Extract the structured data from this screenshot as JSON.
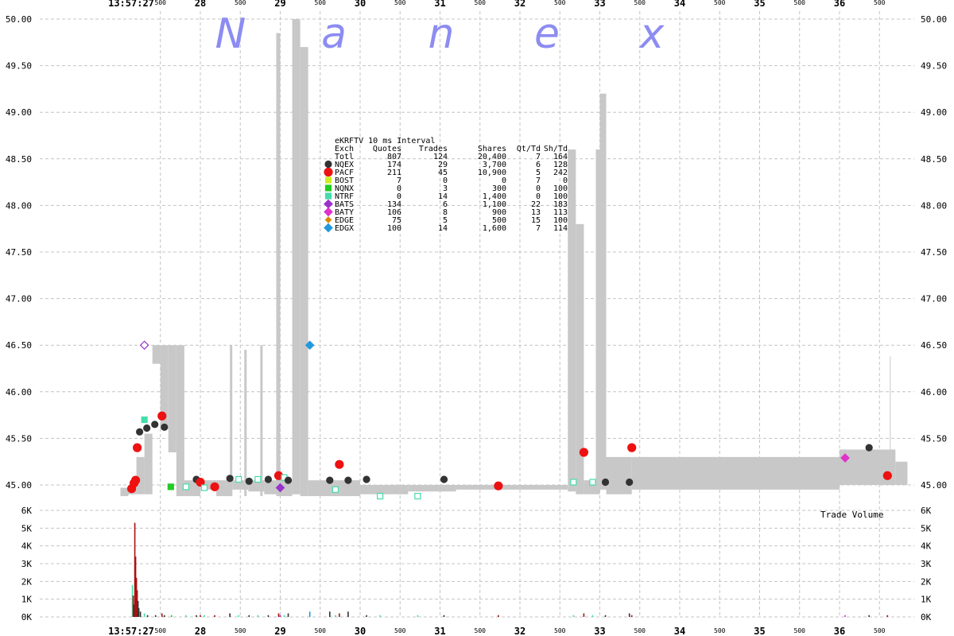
{
  "chart_data": {
    "type": "scatter",
    "subtype": "quote-range-with-trades-and-volume",
    "brand_letters": [
      "N",
      "a",
      "n",
      "e",
      "x"
    ],
    "title": "eKRFTV 10 ms Interval",
    "price_axis": {
      "ylim": [
        44.88,
        50.0
      ],
      "ticks": [
        "50.00",
        "49.50",
        "49.00",
        "48.50",
        "48.00",
        "47.50",
        "47.00",
        "46.50",
        "46.00",
        "45.50",
        "45.00"
      ]
    },
    "volume_axis": {
      "label": "Trade Volume",
      "ylim": [
        0,
        6000
      ],
      "ticks": [
        "6K",
        "5K",
        "4K",
        "3K",
        "2K",
        "1K",
        "0K"
      ]
    },
    "time_axis": {
      "second_labels": [
        "28",
        "29",
        "30",
        "31",
        "32",
        "33",
        "34",
        "35",
        "36"
      ],
      "start_time_label": "13:57:27",
      "ms_label": "500",
      "xlim": [
        27.0,
        37.0
      ],
      "grid": true
    },
    "legend": {
      "header": [
        "Exch",
        "Quotes",
        "Trades",
        "Shares",
        "Qt/Td",
        "Sh/Td"
      ],
      "rows": [
        {
          "exch": "Totl",
          "quotes": "807",
          "trades": "124",
          "shares": "20,400",
          "qt_td": "7",
          "sh_td": "164",
          "marker": "none",
          "color": ""
        },
        {
          "exch": "NQEX",
          "quotes": "174",
          "trades": "29",
          "shares": "3,700",
          "qt_td": "6",
          "sh_td": "128",
          "marker": "circle",
          "color": "#333333"
        },
        {
          "exch": "PACF",
          "quotes": "211",
          "trades": "45",
          "shares": "10,900",
          "qt_td": "5",
          "sh_td": "242",
          "marker": "circle-lg",
          "color": "#ee1111"
        },
        {
          "exch": "BOST",
          "quotes": "7",
          "trades": "0",
          "shares": "0",
          "qt_td": "7",
          "sh_td": "0",
          "marker": "square",
          "color": "#ccee22"
        },
        {
          "exch": "NQNX",
          "quotes": "0",
          "trades": "3",
          "shares": "300",
          "qt_td": "0",
          "sh_td": "100",
          "marker": "square",
          "color": "#22cc22"
        },
        {
          "exch": "NTRF",
          "quotes": "0",
          "trades": "14",
          "shares": "1,400",
          "qt_td": "0",
          "sh_td": "100",
          "marker": "square",
          "color": "#44ddaa"
        },
        {
          "exch": "BATS",
          "quotes": "134",
          "trades": "6",
          "shares": "1,100",
          "qt_td": "22",
          "sh_td": "183",
          "marker": "diamond",
          "color": "#9933cc"
        },
        {
          "exch": "BATY",
          "quotes": "106",
          "trades": "8",
          "shares": "900",
          "qt_td": "13",
          "sh_td": "113",
          "marker": "diamond",
          "color": "#dd33cc"
        },
        {
          "exch": "EDGE",
          "quotes": "75",
          "trades": "5",
          "shares": "500",
          "qt_td": "15",
          "sh_td": "100",
          "marker": "diamond-sm",
          "color": "#dd8800"
        },
        {
          "exch": "EDGX",
          "quotes": "100",
          "trades": "14",
          "shares": "1,600",
          "qt_td": "7",
          "sh_td": "114",
          "marker": "diamond",
          "color": "#2299dd"
        }
      ]
    },
    "quote_range": {
      "color": "#c8c8c8",
      "segments": [
        [
          27.0,
          27.1,
          44.88,
          44.97
        ],
        [
          27.1,
          27.2,
          44.9,
          45.0
        ],
        [
          27.2,
          27.3,
          44.9,
          45.3
        ],
        [
          27.3,
          27.4,
          44.9,
          45.55
        ],
        [
          27.4,
          27.5,
          46.3,
          46.5
        ],
        [
          27.5,
          27.6,
          45.6,
          46.5
        ],
        [
          27.6,
          27.7,
          45.35,
          46.5
        ],
        [
          27.7,
          27.8,
          44.88,
          46.5
        ],
        [
          27.8,
          28.0,
          44.88,
          45.05
        ],
        [
          28.0,
          28.2,
          44.95,
          45.05
        ],
        [
          28.2,
          28.4,
          44.88,
          45.05
        ],
        [
          28.37,
          28.4,
          44.88,
          46.5
        ],
        [
          28.4,
          28.6,
          44.95,
          45.05
        ],
        [
          28.55,
          28.58,
          44.88,
          46.45
        ],
        [
          28.6,
          28.8,
          44.93,
          45.05
        ],
        [
          28.75,
          28.78,
          44.88,
          46.5
        ],
        [
          28.8,
          28.95,
          44.9,
          45.05
        ],
        [
          28.95,
          29.0,
          44.88,
          49.85
        ],
        [
          29.0,
          29.15,
          44.88,
          45.05
        ],
        [
          29.15,
          29.25,
          44.9,
          50.0
        ],
        [
          29.25,
          29.35,
          44.88,
          49.7
        ],
        [
          29.35,
          30.0,
          44.88,
          45.05
        ],
        [
          30.0,
          30.6,
          44.9,
          45.0
        ],
        [
          30.6,
          31.2,
          44.93,
          45.0
        ],
        [
          31.2,
          32.0,
          44.95,
          45.0
        ],
        [
          32.0,
          32.6,
          44.95,
          45.0
        ],
        [
          32.6,
          32.7,
          44.93,
          48.6
        ],
        [
          32.7,
          32.8,
          44.9,
          47.8
        ],
        [
          32.8,
          32.95,
          44.9,
          45.05
        ],
        [
          32.95,
          33.0,
          44.9,
          48.6
        ],
        [
          33.0,
          33.08,
          44.95,
          49.2
        ],
        [
          33.08,
          33.4,
          44.9,
          45.3
        ],
        [
          33.4,
          34.0,
          44.95,
          45.3
        ],
        [
          34.0,
          35.0,
          44.95,
          45.3
        ],
        [
          35.0,
          36.0,
          44.95,
          45.3
        ],
        [
          36.0,
          36.7,
          45.0,
          45.38
        ],
        [
          36.7,
          36.85,
          45.0,
          45.25
        ],
        [
          36.63,
          36.64,
          45.0,
          46.38
        ]
      ]
    },
    "trades": [
      {
        "x": 27.14,
        "y": 44.96,
        "exch": "PACF"
      },
      {
        "x": 27.17,
        "y": 45.02,
        "exch": "PACF"
      },
      {
        "x": 27.19,
        "y": 45.05,
        "exch": "PACF"
      },
      {
        "x": 27.21,
        "y": 45.4,
        "exch": "PACF"
      },
      {
        "x": 27.24,
        "y": 45.57,
        "exch": "NQEX"
      },
      {
        "x": 27.3,
        "y": 45.7,
        "exch": "NTRF"
      },
      {
        "x": 27.3,
        "y": 46.5,
        "exch": "BATS"
      },
      {
        "x": 27.33,
        "y": 45.61,
        "exch": "NQEX"
      },
      {
        "x": 27.43,
        "y": 45.65,
        "exch": "NQEX"
      },
      {
        "x": 27.52,
        "y": 45.74,
        "exch": "PACF"
      },
      {
        "x": 27.55,
        "y": 45.62,
        "exch": "NQEX"
      },
      {
        "x": 27.63,
        "y": 44.98,
        "exch": "NQNX"
      },
      {
        "x": 27.82,
        "y": 44.98,
        "exch": "NTRF"
      },
      {
        "x": 27.95,
        "y": 45.06,
        "exch": "NQEX"
      },
      {
        "x": 28.0,
        "y": 45.03,
        "exch": "PACF"
      },
      {
        "x": 28.05,
        "y": 44.97,
        "exch": "NTRF"
      },
      {
        "x": 28.18,
        "y": 44.98,
        "exch": "PACF"
      },
      {
        "x": 28.37,
        "y": 45.07,
        "exch": "NQEX"
      },
      {
        "x": 28.48,
        "y": 45.06,
        "exch": "NTRF"
      },
      {
        "x": 28.61,
        "y": 45.04,
        "exch": "NQEX"
      },
      {
        "x": 28.72,
        "y": 45.06,
        "exch": "NTRF"
      },
      {
        "x": 28.85,
        "y": 45.06,
        "exch": "NQEX"
      },
      {
        "x": 28.98,
        "y": 45.1,
        "exch": "PACF"
      },
      {
        "x": 29.0,
        "y": 44.97,
        "exch": "BATS"
      },
      {
        "x": 29.05,
        "y": 45.08,
        "exch": "NTRF"
      },
      {
        "x": 29.1,
        "y": 45.05,
        "exch": "NQEX"
      },
      {
        "x": 29.37,
        "y": 46.5,
        "exch": "EDGX"
      },
      {
        "x": 29.62,
        "y": 45.05,
        "exch": "NQEX"
      },
      {
        "x": 29.69,
        "y": 44.95,
        "exch": "NTRF"
      },
      {
        "x": 29.74,
        "y": 45.22,
        "exch": "PACF"
      },
      {
        "x": 29.85,
        "y": 45.05,
        "exch": "NQEX"
      },
      {
        "x": 30.08,
        "y": 45.06,
        "exch": "NQEX"
      },
      {
        "x": 30.25,
        "y": 44.88,
        "exch": "NTRF"
      },
      {
        "x": 30.72,
        "y": 44.88,
        "exch": "NTRF"
      },
      {
        "x": 31.05,
        "y": 45.06,
        "exch": "NQEX"
      },
      {
        "x": 31.73,
        "y": 44.99,
        "exch": "PACF"
      },
      {
        "x": 32.67,
        "y": 45.03,
        "exch": "NTRF"
      },
      {
        "x": 32.8,
        "y": 45.35,
        "exch": "PACF"
      },
      {
        "x": 32.91,
        "y": 45.03,
        "exch": "NTRF"
      },
      {
        "x": 33.07,
        "y": 45.03,
        "exch": "NQEX"
      },
      {
        "x": 33.37,
        "y": 45.03,
        "exch": "NQEX"
      },
      {
        "x": 33.4,
        "y": 45.4,
        "exch": "PACF"
      },
      {
        "x": 36.07,
        "y": 45.29,
        "exch": "BATY"
      },
      {
        "x": 36.37,
        "y": 45.4,
        "exch": "NQEX"
      },
      {
        "x": 36.6,
        "y": 45.1,
        "exch": "PACF"
      }
    ],
    "volume_bars": [
      {
        "x": 27.15,
        "v": 1800,
        "exch": "NTRF"
      },
      {
        "x": 27.16,
        "v": 1200,
        "exch": "PACF"
      },
      {
        "x": 27.17,
        "v": 700,
        "exch": "NQEX"
      },
      {
        "x": 27.18,
        "v": 5300,
        "exch": "PACF"
      },
      {
        "x": 27.19,
        "v": 3400,
        "exch": "PACF"
      },
      {
        "x": 27.2,
        "v": 2200,
        "exch": "PACF"
      },
      {
        "x": 27.21,
        "v": 1500,
        "exch": "PACF"
      },
      {
        "x": 27.22,
        "v": 900,
        "exch": "NQEX"
      },
      {
        "x": 27.23,
        "v": 500,
        "exch": "NQEX"
      },
      {
        "x": 27.25,
        "v": 300,
        "exch": "NQEX"
      },
      {
        "x": 27.3,
        "v": 200,
        "exch": "NTRF"
      },
      {
        "x": 27.34,
        "v": 100,
        "exch": "NQEX"
      },
      {
        "x": 27.44,
        "v": 100,
        "exch": "NQEX"
      },
      {
        "x": 27.52,
        "v": 200,
        "exch": "PACF"
      },
      {
        "x": 27.55,
        "v": 100,
        "exch": "NQEX"
      },
      {
        "x": 27.64,
        "v": 100,
        "exch": "NQNX"
      },
      {
        "x": 27.82,
        "v": 100,
        "exch": "NTRF"
      },
      {
        "x": 27.95,
        "v": 100,
        "exch": "NQEX"
      },
      {
        "x": 28.0,
        "v": 100,
        "exch": "PACF"
      },
      {
        "x": 28.05,
        "v": 100,
        "exch": "NTRF"
      },
      {
        "x": 28.18,
        "v": 100,
        "exch": "PACF"
      },
      {
        "x": 28.37,
        "v": 200,
        "exch": "NQEX"
      },
      {
        "x": 28.48,
        "v": 100,
        "exch": "NTRF"
      },
      {
        "x": 28.61,
        "v": 100,
        "exch": "NQEX"
      },
      {
        "x": 28.72,
        "v": 100,
        "exch": "NTRF"
      },
      {
        "x": 28.85,
        "v": 100,
        "exch": "NQEX"
      },
      {
        "x": 28.98,
        "v": 200,
        "exch": "PACF"
      },
      {
        "x": 29.0,
        "v": 100,
        "exch": "BATS"
      },
      {
        "x": 29.05,
        "v": 100,
        "exch": "NTRF"
      },
      {
        "x": 29.1,
        "v": 200,
        "exch": "NQEX"
      },
      {
        "x": 29.37,
        "v": 300,
        "exch": "EDGX"
      },
      {
        "x": 29.62,
        "v": 300,
        "exch": "NQEX"
      },
      {
        "x": 29.69,
        "v": 100,
        "exch": "NTRF"
      },
      {
        "x": 29.74,
        "v": 200,
        "exch": "PACF"
      },
      {
        "x": 29.85,
        "v": 300,
        "exch": "NQEX"
      },
      {
        "x": 30.08,
        "v": 100,
        "exch": "NQEX"
      },
      {
        "x": 30.25,
        "v": 100,
        "exch": "NTRF"
      },
      {
        "x": 30.72,
        "v": 100,
        "exch": "NTRF"
      },
      {
        "x": 31.05,
        "v": 100,
        "exch": "NQEX"
      },
      {
        "x": 31.73,
        "v": 100,
        "exch": "PACF"
      },
      {
        "x": 32.67,
        "v": 100,
        "exch": "NTRF"
      },
      {
        "x": 32.8,
        "v": 200,
        "exch": "PACF"
      },
      {
        "x": 32.91,
        "v": 100,
        "exch": "NTRF"
      },
      {
        "x": 33.07,
        "v": 100,
        "exch": "NQEX"
      },
      {
        "x": 33.37,
        "v": 200,
        "exch": "NQEX"
      },
      {
        "x": 33.4,
        "v": 100,
        "exch": "PACF"
      },
      {
        "x": 36.07,
        "v": 100,
        "exch": "BATY"
      },
      {
        "x": 36.37,
        "v": 100,
        "exch": "NQEX"
      },
      {
        "x": 36.6,
        "v": 100,
        "exch": "PACF"
      }
    ]
  }
}
